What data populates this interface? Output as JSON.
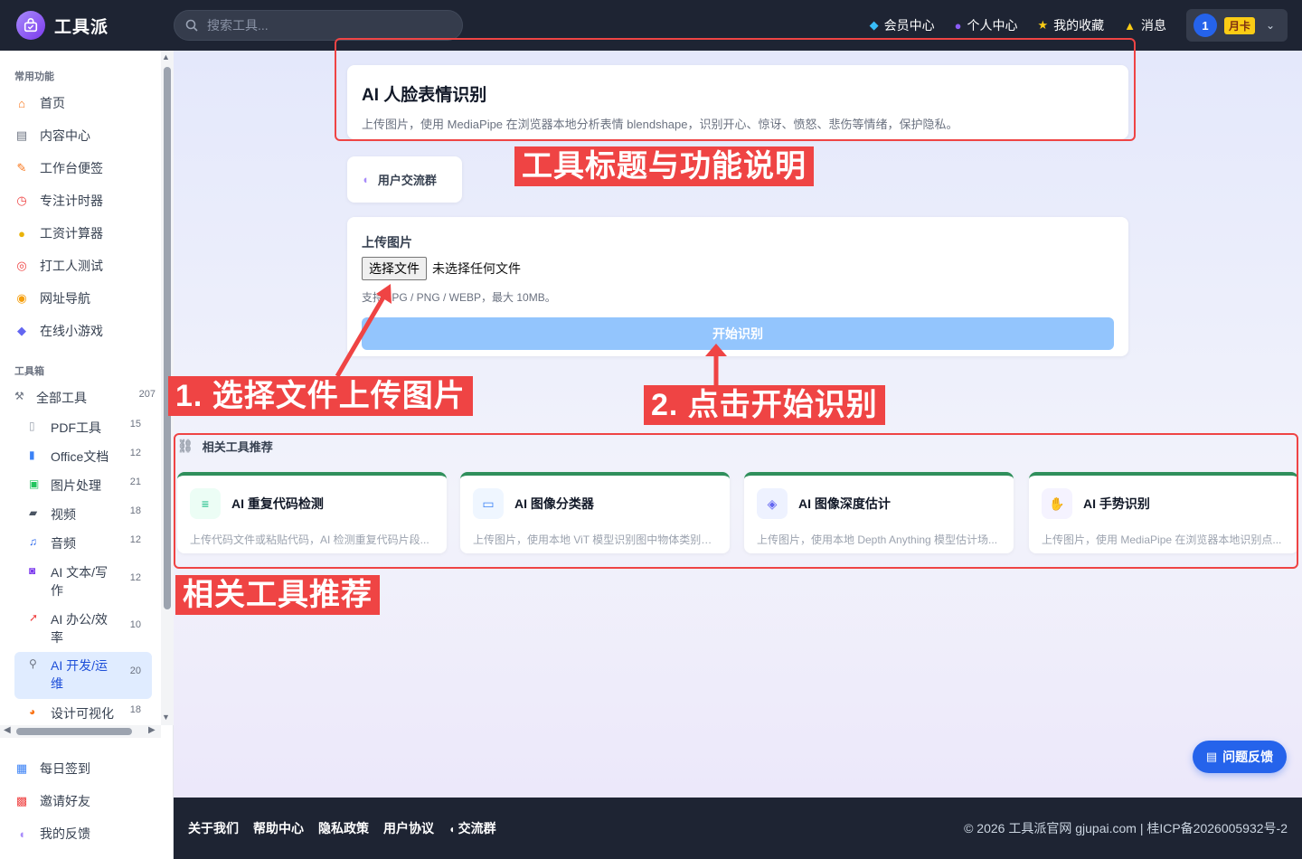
{
  "brand": {
    "name": "工具派"
  },
  "search": {
    "placeholder": "搜索工具..."
  },
  "topnav": {
    "vip": "会员中心",
    "profile": "个人中心",
    "favorites": "我的收藏",
    "messages": "消息",
    "user_avatar": "1",
    "plan": "月卡"
  },
  "sidebar": {
    "common_title": "常用功能",
    "common": [
      "首页",
      "内容中心",
      "工作台便签",
      "专注计时器",
      "工资计算器",
      "打工人测试",
      "网址导航",
      "在线小游戏"
    ],
    "toolbox_title": "工具箱",
    "all_tools": {
      "label": "全部工具",
      "count": "207"
    },
    "categories": [
      {
        "label": "PDF工具",
        "count": "15"
      },
      {
        "label": "Office文档",
        "count": "12"
      },
      {
        "label": "图片处理",
        "count": "21"
      },
      {
        "label": "视频",
        "count": "18"
      },
      {
        "label": "音频",
        "count": "12"
      },
      {
        "label": "AI 文本/写作",
        "count": "12"
      },
      {
        "label": "AI 办公/效率",
        "count": "10"
      },
      {
        "label": "AI 开发/运维",
        "count": "20"
      },
      {
        "label": "设计可视化",
        "count": "18"
      }
    ],
    "bottom": [
      "每日签到",
      "邀请好友",
      "我的反馈"
    ]
  },
  "tool": {
    "title": "AI 人脸表情识别",
    "description": "上传图片，使用 MediaPipe 在浏览器本地分析表情 blendshape，识别开心、惊讶、愤怒、悲伤等情绪，保护隐私。",
    "group_label": "用户交流群",
    "upload_label": "上传图片",
    "file_button": "选择文件",
    "file_status": "未选择任何文件",
    "hint": "支持 JPG / PNG / WEBP，最大 10MB。",
    "start_button": "开始识别"
  },
  "related": {
    "title": "相关工具推荐",
    "items": [
      {
        "name": "AI 重复代码检测",
        "desc": "上传代码文件或粘贴代码，AI 检测重复代码片段..."
      },
      {
        "name": "AI 图像分类器",
        "desc": "上传图片，使用本地 ViT 模型识别图中物体类别，..."
      },
      {
        "name": "AI 图像深度估计",
        "desc": "上传图片，使用本地 Depth Anything 模型估计场..."
      },
      {
        "name": "AI 手势识别",
        "desc": "上传图片，使用 MediaPipe 在浏览器本地识别点..."
      }
    ]
  },
  "feedback_button": "问题反馈",
  "annotations": {
    "title_note": "工具标题与功能说明",
    "step1": "1. 选择文件上传图片",
    "step2": "2. 点击开始识别",
    "related_note": "相关工具推荐"
  },
  "footer": {
    "links": [
      "关于我们",
      "帮助中心",
      "隐私政策",
      "用户协议",
      "交流群"
    ],
    "copyright": "© 2026 工具派官网 gjupai.com | 桂ICP备2026005932号-2"
  },
  "colors": {
    "accent": "#2563eb",
    "annotation": "#ef4444",
    "topbar": "#1e2433"
  }
}
